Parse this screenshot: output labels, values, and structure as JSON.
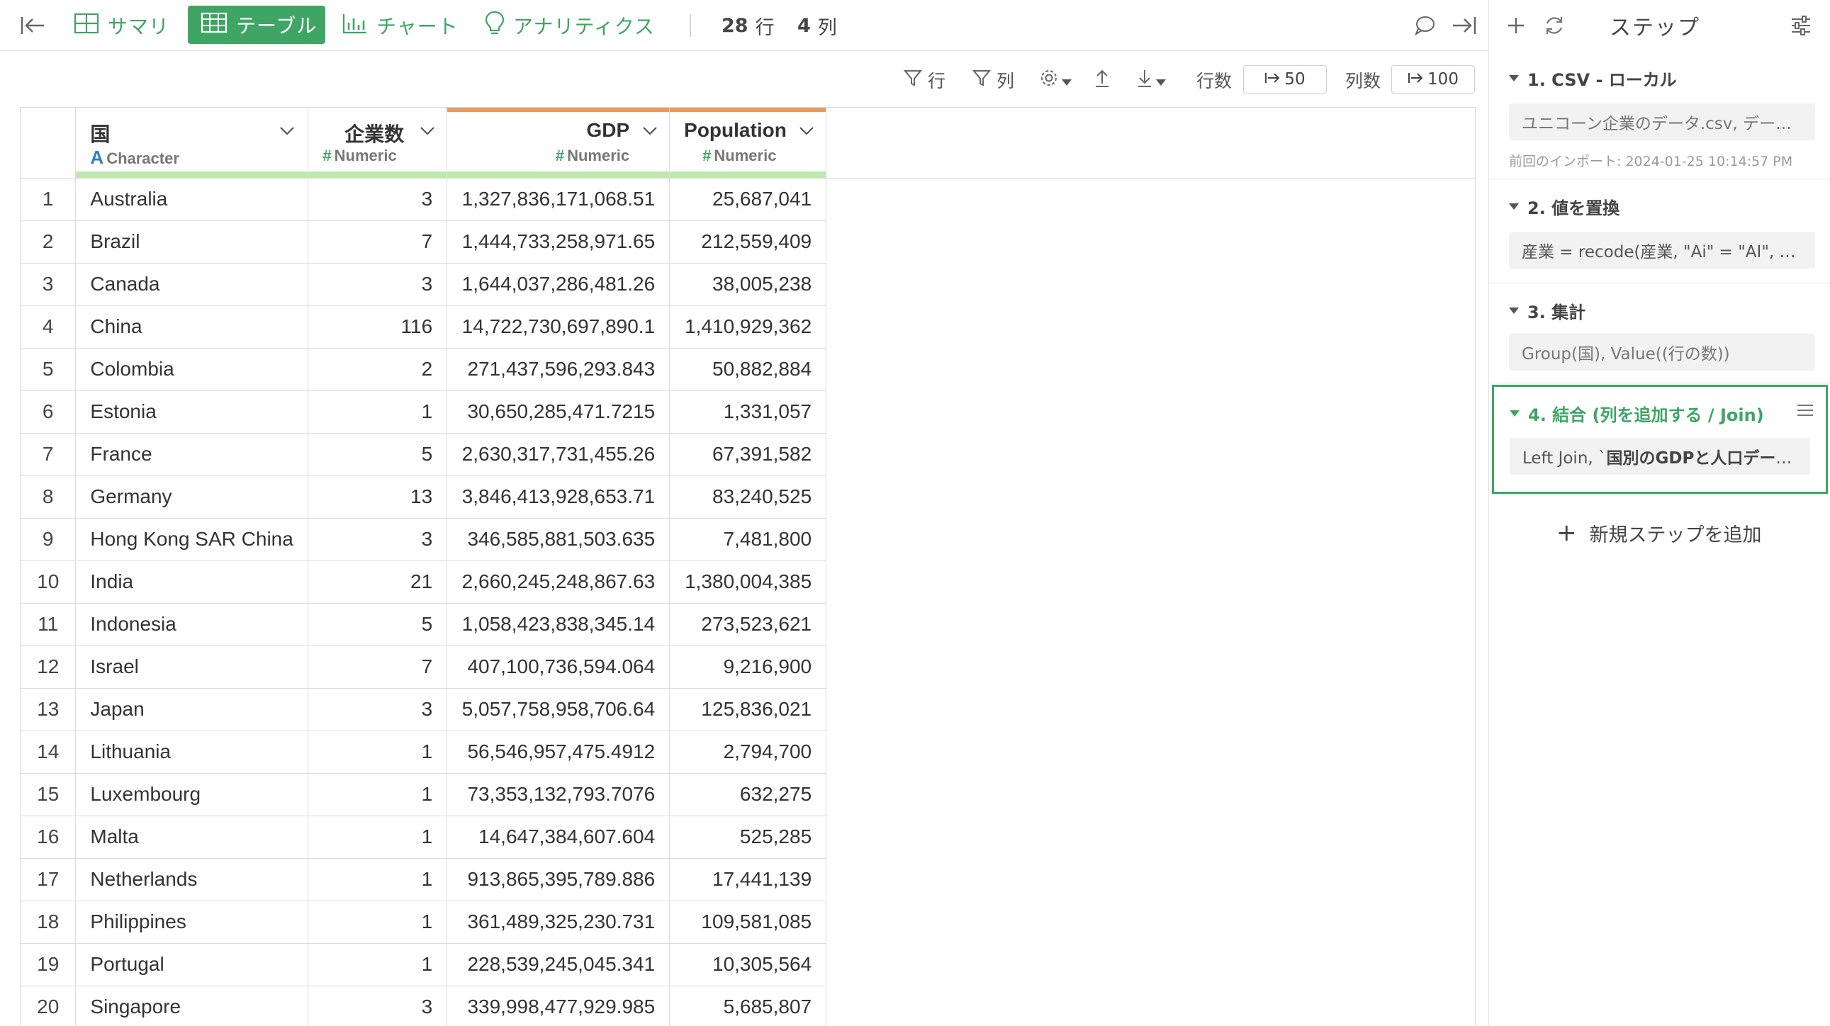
{
  "topbar": {
    "tabs": [
      {
        "label": "サマリ",
        "icon": "summary-grid-icon"
      },
      {
        "label": "テーブル",
        "icon": "table-icon"
      },
      {
        "label": "チャート",
        "icon": "chart-icon"
      },
      {
        "label": "アナリティクス",
        "icon": "lightbulb-icon"
      }
    ],
    "row_count": "28",
    "row_unit": "行",
    "col_count": "4",
    "col_unit": "列",
    "accent_color": "#3fa564"
  },
  "toolbar": {
    "row_filter_label": "行",
    "col_filter_label": "列",
    "rows_label": "行数",
    "rows_value": "50",
    "cols_label": "列数",
    "cols_value": "100"
  },
  "table": {
    "columns": [
      {
        "name": "国",
        "type": "Character",
        "type_symbol": "A"
      },
      {
        "name": "企業数",
        "type": "Numeric",
        "type_symbol": "#"
      },
      {
        "name": "GDP",
        "type": "Numeric",
        "type_symbol": "#"
      },
      {
        "name": "Population",
        "type": "Numeric",
        "type_symbol": "#"
      }
    ],
    "rows": [
      [
        "1",
        "Australia",
        "3",
        "1,327,836,171,068.51",
        "25,687,041"
      ],
      [
        "2",
        "Brazil",
        "7",
        "1,444,733,258,971.65",
        "212,559,409"
      ],
      [
        "3",
        "Canada",
        "3",
        "1,644,037,286,481.26",
        "38,005,238"
      ],
      [
        "4",
        "China",
        "116",
        "14,722,730,697,890.1",
        "1,410,929,362"
      ],
      [
        "5",
        "Colombia",
        "2",
        "271,437,596,293.843",
        "50,882,884"
      ],
      [
        "6",
        "Estonia",
        "1",
        "30,650,285,471.7215",
        "1,331,057"
      ],
      [
        "7",
        "France",
        "5",
        "2,630,317,731,455.26",
        "67,391,582"
      ],
      [
        "8",
        "Germany",
        "13",
        "3,846,413,928,653.71",
        "83,240,525"
      ],
      [
        "9",
        "Hong Kong SAR China",
        "3",
        "346,585,881,503.635",
        "7,481,800"
      ],
      [
        "10",
        "India",
        "21",
        "2,660,245,248,867.63",
        "1,380,004,385"
      ],
      [
        "11",
        "Indonesia",
        "5",
        "1,058,423,838,345.14",
        "273,523,621"
      ],
      [
        "12",
        "Israel",
        "7",
        "407,100,736,594.064",
        "9,216,900"
      ],
      [
        "13",
        "Japan",
        "3",
        "5,057,758,958,706.64",
        "125,836,021"
      ],
      [
        "14",
        "Lithuania",
        "1",
        "56,546,957,475.4912",
        "2,794,700"
      ],
      [
        "15",
        "Luxembourg",
        "1",
        "73,353,132,793.7076",
        "632,275"
      ],
      [
        "16",
        "Malta",
        "1",
        "14,647,384,607.604",
        "525,285"
      ],
      [
        "17",
        "Netherlands",
        "1",
        "913,865,395,789.886",
        "17,441,139"
      ],
      [
        "18",
        "Philippines",
        "1",
        "361,489,325,230.731",
        "109,581,085"
      ],
      [
        "19",
        "Portugal",
        "1",
        "228,539,245,045.341",
        "10,305,564"
      ],
      [
        "20",
        "Singapore",
        "3",
        "339,998,477,929.985",
        "5,685,807"
      ]
    ]
  },
  "steps": {
    "title": "ステップ",
    "items": [
      {
        "title": "1. CSV - ローカル",
        "body": "ユニコーン企業のデータ.csv, データ...",
        "meta": "前回のインポート: 2024-01-25 10:14:57 PM"
      },
      {
        "title": "2. 値を置換",
        "body": "産業 = recode(産業, \"Ai\" = \"AI\", \"Art..."
      },
      {
        "title": "3. 集計",
        "body": "Group(国), Value((行の数))"
      },
      {
        "title": "4. 結合 (列を追加する / Join)",
        "body_prefix": "Left Join, `",
        "body_bold": "国別のGDPと人口データ..."
      }
    ],
    "add_step_label": "新規ステップを追加"
  }
}
